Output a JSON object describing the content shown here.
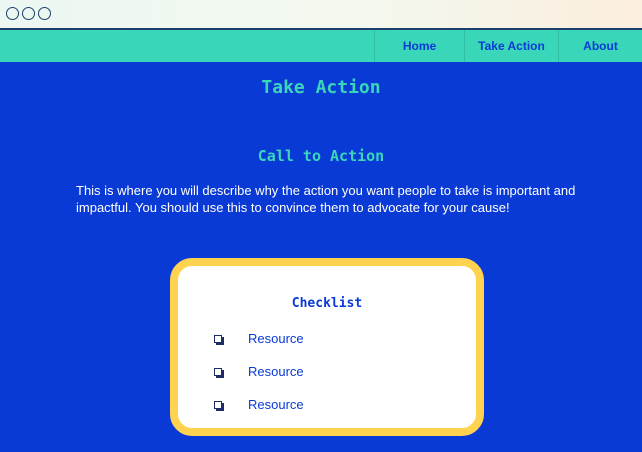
{
  "nav": {
    "items": [
      {
        "label": "Home"
      },
      {
        "label": "Take Action"
      },
      {
        "label": "About"
      }
    ]
  },
  "page": {
    "title": "Take Action"
  },
  "cta": {
    "heading": "Call to Action",
    "description": "This is where you will describe why the action you want people to take is important and impactful. You should use this to convince them to advocate for your cause!"
  },
  "checklist": {
    "title": "Checklist",
    "items": [
      {
        "label": "Resource",
        "checked": false
      },
      {
        "label": "Resource",
        "checked": false
      },
      {
        "label": "Resource",
        "checked": false
      }
    ]
  },
  "colors": {
    "background": "#0a3ad6",
    "accent_teal": "#3ad6b9",
    "card_border": "#ffd250",
    "text_white": "#ffffff"
  },
  "icons": {
    "window_controls": [
      "circle-icon",
      "circle-icon",
      "circle-icon"
    ],
    "checkbox": "checkbox-icon"
  }
}
